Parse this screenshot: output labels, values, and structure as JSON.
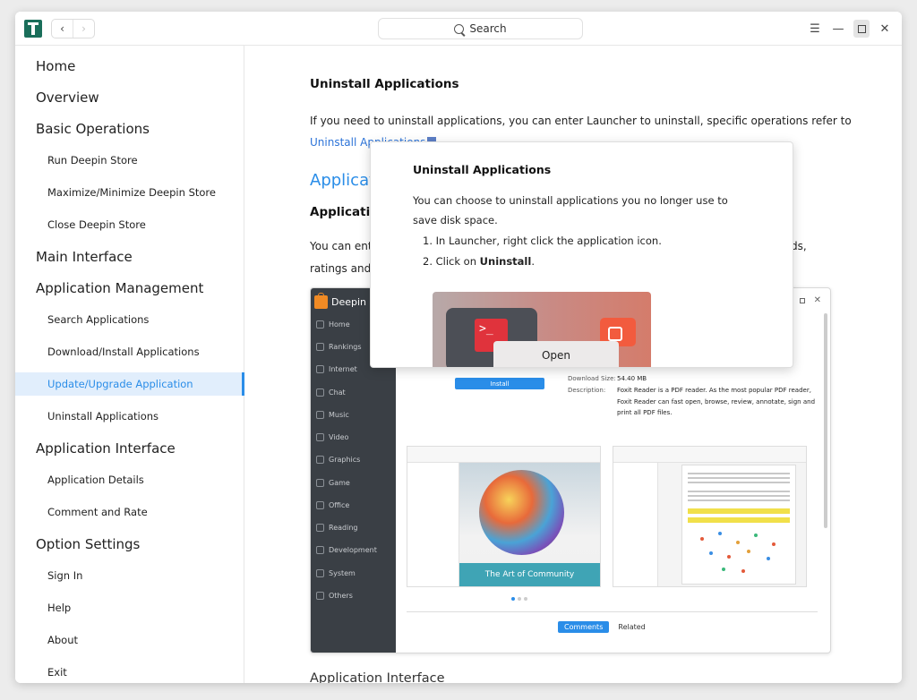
{
  "window": {
    "search_label": "Search"
  },
  "sidebar": {
    "items": [
      {
        "label": "Home",
        "level": 1
      },
      {
        "label": "Overview",
        "level": 1
      },
      {
        "label": "Basic Operations",
        "level": 1
      },
      {
        "label": "Run Deepin Store",
        "level": 2
      },
      {
        "label": "Maximize/Minimize Deepin Store",
        "level": 2
      },
      {
        "label": "Close Deepin Store",
        "level": 2
      },
      {
        "label": "Main Interface",
        "level": 1
      },
      {
        "label": "Application Management",
        "level": 1
      },
      {
        "label": "Search Applications",
        "level": 2
      },
      {
        "label": "Download/Install Applications",
        "level": 2
      },
      {
        "label": "Update/Upgrade Application",
        "level": 2,
        "active": true
      },
      {
        "label": "Uninstall Applications",
        "level": 2
      },
      {
        "label": "Application Interface",
        "level": 1
      },
      {
        "label": "Application Details",
        "level": 2
      },
      {
        "label": "Comment and Rate",
        "level": 2
      },
      {
        "label": "Option Settings",
        "level": 1
      },
      {
        "label": "Sign In",
        "level": 2
      },
      {
        "label": "Help",
        "level": 2
      },
      {
        "label": "About",
        "level": 2
      },
      {
        "label": "Exit",
        "level": 2
      }
    ]
  },
  "content": {
    "uninstall_heading": "Uninstall Applications",
    "uninstall_text": "If you need to uninstall applications, you can enter Launcher to uninstall, specific operations refer to",
    "uninstall_link": "Uninstall Applications",
    "uninstall_period": ".",
    "app_heading_partial": "Applicat",
    "app_sub_partial": "Applicatio",
    "p2_line1_partial": "You can ente",
    "p2_line2_partial": "ratings and s",
    "p2_right_partial": "ds,",
    "next_heading_partial": "Application Interface"
  },
  "screenshot": {
    "brand": "Deepin S",
    "categories": [
      "Home",
      "Rankings",
      "Internet",
      "Chat",
      "Music",
      "Video",
      "Graphics",
      "Game",
      "Office",
      "Reading",
      "Development",
      "System",
      "Others"
    ],
    "install_label": "Install",
    "download_size_label": "Download Size:",
    "download_size_value": "54.40 MB",
    "description_label": "Description:",
    "description_value": "Foxit Reader is a PDF reader. As the most popular PDF reader, Foxit Reader can fast open, browse, review, annotate, sign and print all PDF files.",
    "thumb_title": "The Art of Community",
    "tab_comments": "Comments",
    "tab_related": "Related"
  },
  "popup": {
    "title": "Uninstall Applications",
    "description": "You can choose to uninstall applications you no longer use to save disk space.",
    "step1": "1. In Launcher, right click the application icon.",
    "step2_prefix": "2. Click on ",
    "step2_bold": "Uninstall",
    "step2_suffix": ".",
    "terminal_glyph": ">_",
    "menu_open": "Open"
  }
}
